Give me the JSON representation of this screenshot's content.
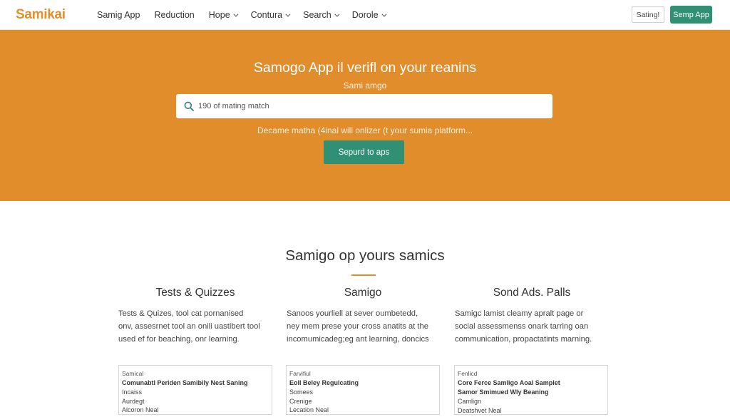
{
  "header": {
    "logo": "Samikai",
    "nav": [
      {
        "label": "Samig App",
        "dropdown": false
      },
      {
        "label": "Reduction",
        "dropdown": false
      },
      {
        "label": "Hope",
        "dropdown": true
      },
      {
        "label": "Contura",
        "dropdown": true
      },
      {
        "label": "Search",
        "dropdown": true
      },
      {
        "label": "Dorole",
        "dropdown": true
      }
    ],
    "signin_label": "Sating!",
    "app_button_label": "Semp App"
  },
  "hero": {
    "title": "Samogo App il verifl on your reanins",
    "subtitle": "Sami amgo",
    "search": {
      "value": "190 of mating match",
      "icon": "search-icon"
    },
    "description": "Decame matha (4inal will onlizer (t your sumia platform...",
    "cta_label": "Sepurd to aps"
  },
  "section": {
    "title": "Samigo op yours samics",
    "columns": [
      {
        "heading": "Tests & Quizzes",
        "text": [
          "Tests & Quizes, tool cat pornanised",
          "onv, assesrnet tool an onili uastibert tool",
          "used ef for beaching, onr learning."
        ],
        "card": {
          "tag": "Samical",
          "title": "Comunabtl Periden Samibily Nest Saning",
          "lines": [
            "Incaiss",
            "Aurdegt",
            "Alcoron Neal"
          ]
        }
      },
      {
        "heading": "Samigo",
        "text": [
          "Sanoos yourliell at sever oumbetedd,",
          "ney mem prese your cross anatits at the",
          "incomumicadeg;eg ant learning, doncics"
        ],
        "card": {
          "tag": "Farvifiul",
          "title": "Eoll Beley Regulcating",
          "lines": [
            "Somees",
            "Crenige",
            "Lecation Neal"
          ]
        }
      },
      {
        "heading": "Sond Ads. Palls",
        "text": [
          "Samigc lamist cleamy apralt page or",
          "social assessmenss onark tarring oan",
          "communication, propactatints marning."
        ],
        "card": {
          "tag": "Fenlicd",
          "title": "Core Ferce Samligo Aoal Samplet",
          "title2": "Samor Smimued Wly Beaning",
          "lines": [
            "Camlign",
            "Deatshvet Neal"
          ]
        }
      }
    ]
  },
  "colors": {
    "accent": "#e28d2c",
    "primary": "#2f9074"
  }
}
